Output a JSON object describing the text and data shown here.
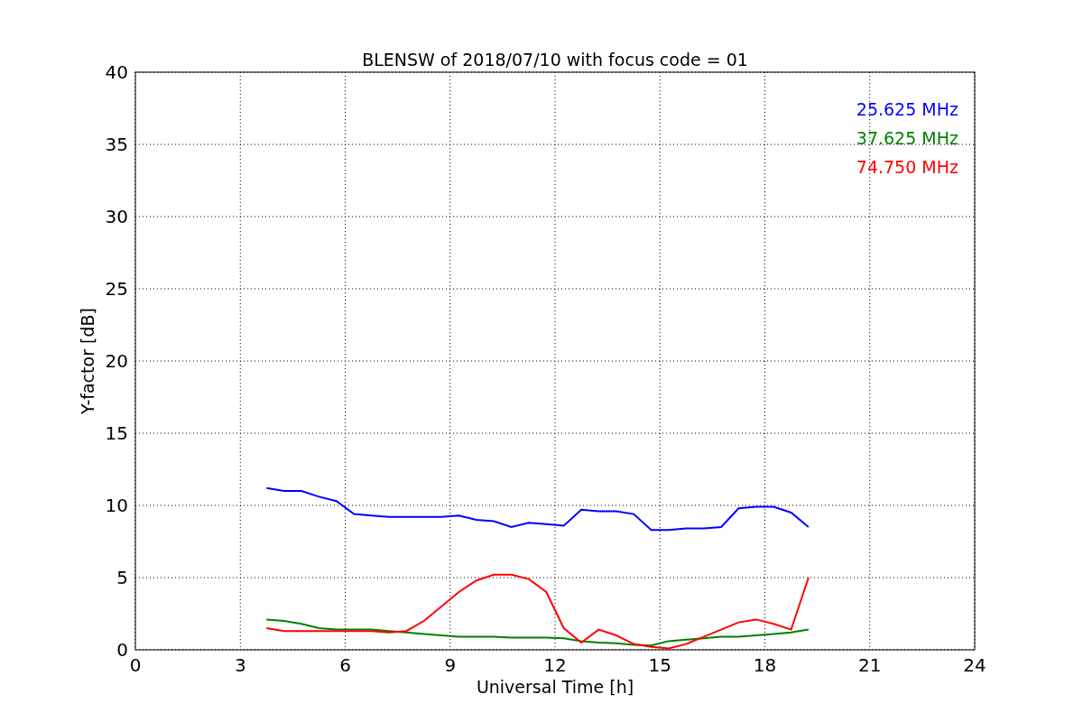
{
  "chart_data": {
    "type": "line",
    "title": "BLENSW of 2018/07/10 with focus code = 01",
    "xlabel": "Universal Time [h]",
    "ylabel": "Y-factor [dB]",
    "x": [
      3.75,
      4.25,
      4.75,
      5.25,
      5.75,
      6.25,
      6.75,
      7.25,
      7.75,
      8.25,
      8.75,
      9.25,
      9.75,
      10.25,
      10.75,
      11.25,
      11.75,
      12.25,
      12.75,
      13.25,
      13.75,
      14.25,
      14.75,
      15.25,
      15.75,
      16.25,
      16.75,
      17.25,
      17.75,
      18.25,
      18.75,
      19.25
    ],
    "series": [
      {
        "name": "25.625 MHz",
        "color": "#0000ff",
        "values": [
          11.2,
          11.0,
          11.0,
          10.6,
          10.3,
          9.4,
          9.3,
          9.2,
          9.2,
          9.2,
          9.2,
          9.3,
          9.0,
          8.9,
          8.5,
          8.8,
          8.7,
          8.6,
          9.7,
          9.6,
          9.6,
          9.4,
          8.3,
          8.3,
          8.4,
          8.4,
          8.5,
          9.8,
          9.9,
          9.9,
          9.5,
          8.5
        ]
      },
      {
        "name": "37.625 MHz",
        "color": "#008000",
        "values": [
          2.1,
          2.0,
          1.8,
          1.5,
          1.4,
          1.4,
          1.4,
          1.3,
          1.2,
          1.1,
          1.0,
          0.9,
          0.9,
          0.9,
          0.85,
          0.85,
          0.85,
          0.8,
          0.6,
          0.5,
          0.45,
          0.35,
          0.3,
          0.6,
          0.7,
          0.8,
          0.9,
          0.9,
          1.0,
          1.1,
          1.2,
          1.4
        ]
      },
      {
        "name": "74.750 MHz",
        "color": "#ff0000",
        "values": [
          1.5,
          1.3,
          1.3,
          1.3,
          1.3,
          1.3,
          1.3,
          1.2,
          1.3,
          2.0,
          3.0,
          4.0,
          4.8,
          5.2,
          5.2,
          4.9,
          4.0,
          1.5,
          0.5,
          1.4,
          1.0,
          0.4,
          0.2,
          0.1,
          0.4,
          0.9,
          1.4,
          1.9,
          2.1,
          1.8,
          1.4,
          5.0
        ]
      }
    ],
    "grid": true,
    "xlim": [
      0,
      24
    ],
    "ylim": [
      0,
      40
    ],
    "xticks": [
      0,
      3,
      6,
      9,
      12,
      15,
      18,
      21,
      24
    ],
    "yticks": [
      0,
      5,
      10,
      15,
      20,
      25,
      30,
      35,
      40
    ]
  }
}
